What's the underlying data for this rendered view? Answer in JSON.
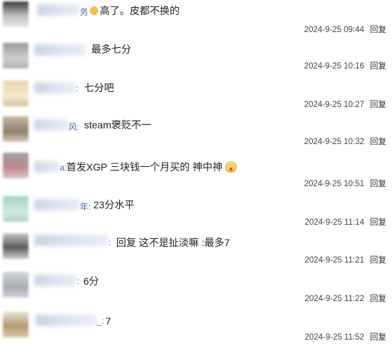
{
  "comments": [
    {
      "suffix": "务",
      "text": "高了。皮都不换的",
      "time": "2024-9-25 09:44",
      "reply": "回复"
    },
    {
      "suffix": "",
      "text": "最多七分",
      "time": "2024-9-25 10:16",
      "reply": "回复"
    },
    {
      "suffix": ":",
      "text": "七分吧",
      "time": "2024-9-25 10:27",
      "reply": "回复"
    },
    {
      "suffix": "风:",
      "text": "steam褒贬不一",
      "time": "2024-9-25 10:32",
      "reply": "回复"
    },
    {
      "suffix": "a:",
      "text": "首发XGP 三块钱一个月买的 神中神",
      "time": "2024-9-25 10:51",
      "reply": "回复"
    },
    {
      "suffix": "年:",
      "text": "23分水平",
      "time": "2024-9-25 11:14",
      "reply": "回复"
    },
    {
      "suffix": ":",
      "text": "回复 这不是扯淡嘛 :最多7",
      "time": "2024-9-25 11:21",
      "reply": "回复"
    },
    {
      "suffix": ":",
      "text": "6分",
      "time": "2024-9-25 11:22",
      "reply": "回复"
    },
    {
      "suffix": "_:",
      "text": "7",
      "time": "2024-9-25 11:52",
      "reply": "回复"
    }
  ]
}
